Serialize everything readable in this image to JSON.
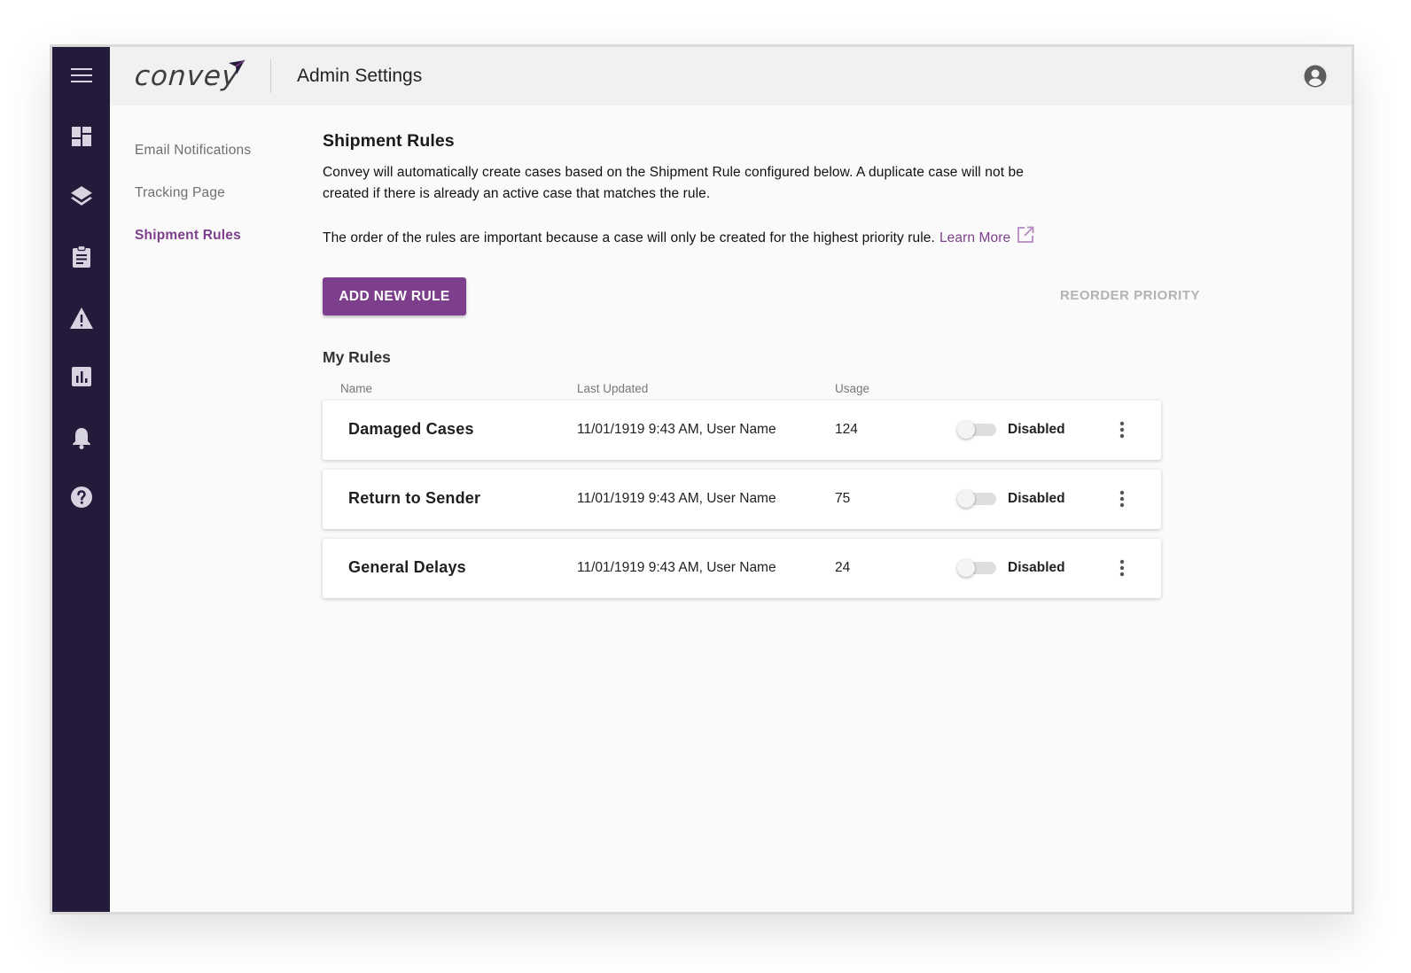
{
  "app": {
    "logo_text": "convey",
    "title": "Admin Settings"
  },
  "rail": {
    "items": [
      {
        "icon": "hamburger-menu-icon"
      },
      {
        "icon": "dashboard-icon"
      },
      {
        "icon": "layers-icon"
      },
      {
        "icon": "clipboard-icon"
      },
      {
        "icon": "warning-icon"
      },
      {
        "icon": "bar-chart-icon"
      },
      {
        "icon": "bell-icon"
      },
      {
        "icon": "help-icon"
      }
    ]
  },
  "subnav": {
    "items": [
      {
        "label": "Email Notifications",
        "active": false
      },
      {
        "label": "Tracking Page",
        "active": false
      },
      {
        "label": "Shipment Rules",
        "active": true
      }
    ]
  },
  "main": {
    "heading": "Shipment Rules",
    "description": "Convey will automatically create cases based on the Shipment Rule configured below. A duplicate case will not be created if there is already an active case that matches the rule.",
    "priority_note": "The order of the rules are important because a case will only be created for the highest priority rule.",
    "learn_more": "Learn More",
    "add_rule_label": "ADD NEW RULE",
    "reorder_label": "REORDER PRIORITY",
    "rules_heading": "My Rules",
    "columns": {
      "name": "Name",
      "last_updated": "Last Updated",
      "usage": "Usage"
    },
    "rules": [
      {
        "name": "Damaged Cases",
        "last_updated": "11/01/1919 9:43 AM, User Name",
        "usage": "124",
        "status": "Disabled",
        "enabled": false
      },
      {
        "name": "Return to Sender",
        "last_updated": "11/01/1919 9:43 AM, User Name",
        "usage": "75",
        "status": "Disabled",
        "enabled": false
      },
      {
        "name": "General Delays",
        "last_updated": "11/01/1919 9:43 AM, User Name",
        "usage": "24",
        "status": "Disabled",
        "enabled": false
      }
    ]
  },
  "colors": {
    "rail_bg": "#241a3a",
    "accent": "#7d3f8c",
    "topbar_bg": "#f0f1f0"
  }
}
